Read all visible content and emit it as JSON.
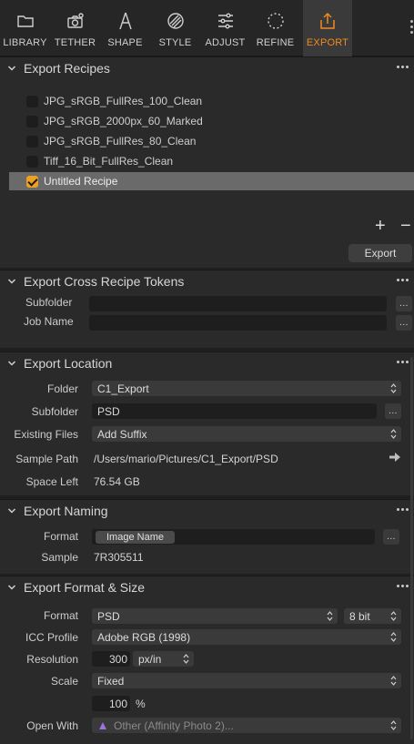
{
  "tabs": [
    {
      "label": "LIBRARY",
      "icon": "folder-icon"
    },
    {
      "label": "TETHER",
      "icon": "camera-icon"
    },
    {
      "label": "SHAPE",
      "icon": "compass-icon"
    },
    {
      "label": "STYLE",
      "icon": "style-icon"
    },
    {
      "label": "ADJUST",
      "icon": "sliders-icon"
    },
    {
      "label": "REFINE",
      "icon": "refine-icon"
    },
    {
      "label": "EXPORT",
      "icon": "export-icon"
    }
  ],
  "active_tab": "EXPORT",
  "accent_color": "#f08a20",
  "recipes": {
    "title": "Export Recipes",
    "items": [
      {
        "label": "JPG_sRGB_FullRes_100_Clean",
        "checked": false
      },
      {
        "label": "JPG_sRGB_2000px_60_Marked",
        "checked": false
      },
      {
        "label": "JPG_sRGB_FullRes_80_Clean",
        "checked": false
      },
      {
        "label": "Tiff_16_Bit_FullRes_Clean",
        "checked": false
      },
      {
        "label": "Untitled Recipe",
        "checked": true
      }
    ],
    "add_label": "+",
    "remove_label": "−",
    "export_label": "Export"
  },
  "tokens": {
    "title": "Export Cross Recipe Tokens",
    "subfolder_label": "Subfolder",
    "subfolder_value": "",
    "jobname_label": "Job Name",
    "jobname_value": "",
    "more_label": "..."
  },
  "location": {
    "title": "Export Location",
    "folder_label": "Folder",
    "folder_value": "C1_Export",
    "subfolder_label": "Subfolder",
    "subfolder_value": "PSD",
    "existing_label": "Existing Files",
    "existing_value": "Add Suffix",
    "sample_label": "Sample Path",
    "sample_value": "/Users/mario/Pictures/C1_Export/PSD",
    "space_label": "Space Left",
    "space_value": "76.54 GB"
  },
  "naming": {
    "title": "Export Naming",
    "format_label": "Format",
    "format_token": "Image Name",
    "sample_label": "Sample",
    "sample_value": "7R305511"
  },
  "format": {
    "title": "Export Format & Size",
    "format_label": "Format",
    "format_value": "PSD",
    "bit_value": "8 bit",
    "icc_label": "ICC Profile",
    "icc_value": "Adobe RGB (1998)",
    "resolution_label": "Resolution",
    "resolution_value": "300",
    "resolution_unit": "px/in",
    "scale_label": "Scale",
    "scale_value": "Fixed",
    "scale_percent": "100",
    "percent_sign": "%",
    "openwith_label": "Open With",
    "openwith_value": "Other (Affinity Photo 2)..."
  }
}
